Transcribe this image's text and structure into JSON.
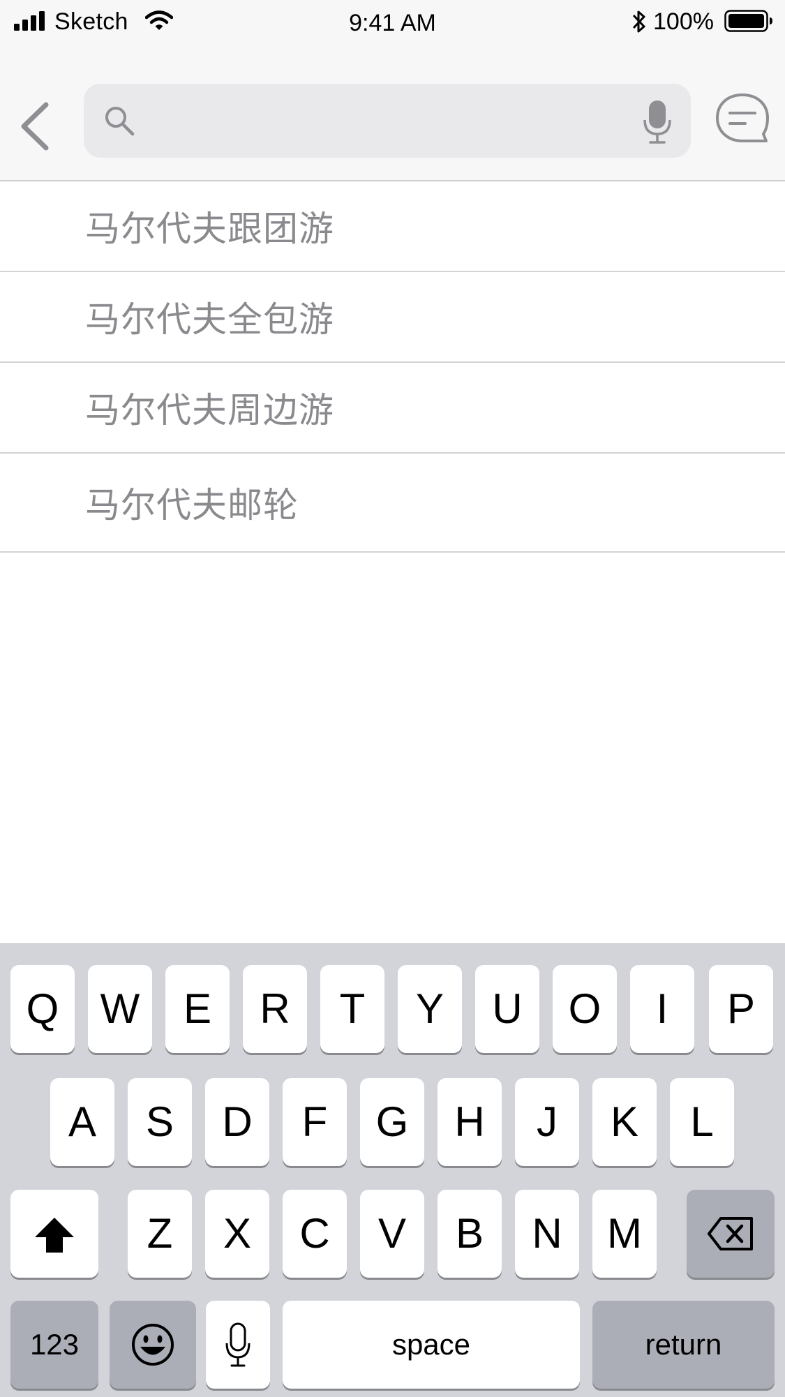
{
  "status_bar": {
    "carrier": "Sketch",
    "time": "9:41 AM",
    "battery": "100%"
  },
  "search": {
    "value": "",
    "placeholder": ""
  },
  "suggestions": [
    "马尔代夫跟团游",
    "马尔代夫全包游",
    "马尔代夫周边游",
    "马尔代夫邮轮"
  ],
  "keyboard": {
    "row1": [
      "Q",
      "W",
      "E",
      "R",
      "T",
      "Y",
      "U",
      "O",
      "I",
      "P"
    ],
    "row2": [
      "A",
      "S",
      "D",
      "F",
      "G",
      "H",
      "J",
      "K",
      "L"
    ],
    "row3": [
      "Z",
      "X",
      "C",
      "V",
      "B",
      "N",
      "M"
    ],
    "numbers_label": "123",
    "space_label": "space",
    "return_label": "return"
  },
  "icons": {
    "signal": "signal-bars-icon",
    "wifi": "wifi-icon",
    "bluetooth": "bluetooth-icon",
    "battery": "battery-icon",
    "back": "chevron-left-icon",
    "search": "search-icon",
    "microphone": "microphone-icon",
    "message": "message-bubble-icon",
    "shift": "shift-arrow-icon",
    "delete": "backspace-icon",
    "emoji": "emoji-icon"
  },
  "colors": {
    "bar_background": "#f7f7f7",
    "search_field": "#e9e9ec",
    "suggestion_text": "#8a8a8e",
    "keyboard_background": "#d2d4da",
    "dark_key": "#abaeb6"
  }
}
